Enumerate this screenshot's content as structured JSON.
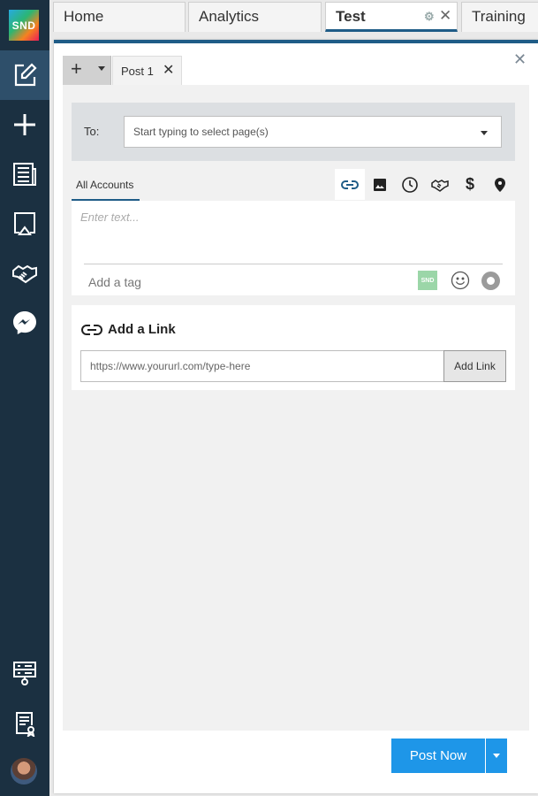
{
  "app": {
    "logo_text": "SND",
    "accent_color": "#1f5c87",
    "sidebar_color": "#1b3041"
  },
  "tabs": [
    {
      "label": "Home",
      "active": false
    },
    {
      "label": "Analytics",
      "active": false
    },
    {
      "label": "Test",
      "active": true
    },
    {
      "label": "Training",
      "active": false
    }
  ],
  "sidebar": {
    "items": [
      {
        "icon": "compose-icon",
        "active": true
      },
      {
        "icon": "plus-icon",
        "active": false
      },
      {
        "icon": "news-icon",
        "active": false
      },
      {
        "icon": "screen-icon",
        "active": false
      },
      {
        "icon": "handshake-icon",
        "active": false
      },
      {
        "icon": "messenger-icon",
        "active": false
      },
      {
        "icon": "server-icon",
        "active": false
      },
      {
        "icon": "certificate-icon",
        "active": false
      },
      {
        "icon": "avatar",
        "active": false
      }
    ]
  },
  "composer": {
    "post_tab_label": "Post 1",
    "to_label": "To:",
    "to_placeholder": "Start typing to select page(s)",
    "accounts_tab": "All Accounts",
    "text_placeholder": "Enter text...",
    "tag_placeholder": "Add a tag",
    "snd_badge": "SND",
    "tools": [
      "link-icon",
      "image-icon",
      "clock-icon",
      "handshake-icon",
      "dollar-icon",
      "location-icon"
    ],
    "dollar_symbol": "$"
  },
  "link_card": {
    "title": "Add a Link",
    "input_placeholder": "https://www.yoururl.com/type-here",
    "button_label": "Add Link"
  },
  "footer": {
    "post_now_label": "Post Now",
    "post_color": "#1e96e8"
  }
}
